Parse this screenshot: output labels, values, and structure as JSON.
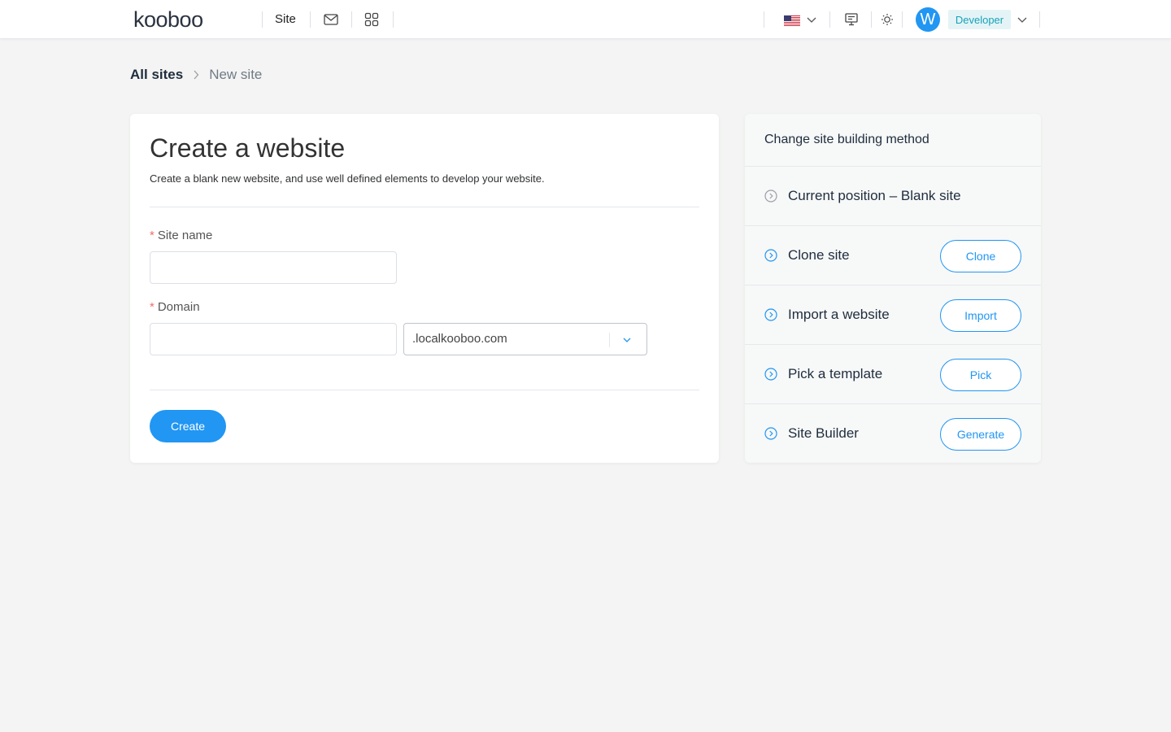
{
  "header": {
    "logo": "kooboo",
    "nav_site": "Site",
    "language": "en-US",
    "avatar_letter": "W",
    "role": "Developer"
  },
  "breadcrumb": {
    "root": "All sites",
    "current": "New site"
  },
  "form": {
    "title": "Create a website",
    "description": "Create a blank new website, and use well defined elements to develop your website.",
    "required_mark": "*",
    "site_name_label": "Site name",
    "site_name_value": "",
    "domain_label": "Domain",
    "domain_value": "",
    "domain_suffix": ".localkooboo.com",
    "create_button": "Create"
  },
  "side_panel": {
    "title": "Change site building method",
    "items": [
      {
        "label": "Current position – Blank site",
        "button": ""
      },
      {
        "label": "Clone site",
        "button": "Clone"
      },
      {
        "label": "Import a website",
        "button": "Import"
      },
      {
        "label": "Pick a template",
        "button": "Pick"
      },
      {
        "label": "Site Builder",
        "button": "Generate"
      }
    ]
  },
  "colors": {
    "primary": "#2196f3",
    "required": "#f56c6c",
    "badge_bg": "#e4f4f6",
    "badge_text": "#17a2b8"
  }
}
